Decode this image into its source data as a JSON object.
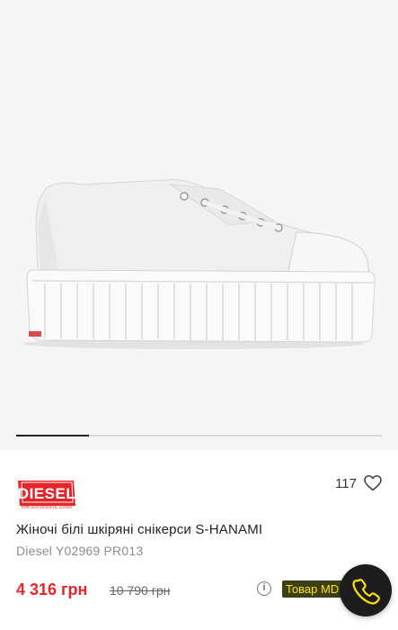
{
  "gallery": {
    "current_image_fraction": 0.2
  },
  "brand": {
    "logo_text": "DIESEL",
    "logo_tagline": "FOR SUCCESSFUL LIVING",
    "color": "#e4262b"
  },
  "likes": {
    "count": "117"
  },
  "product": {
    "title": "Жіночі білі шкіряні снікерси S-HANAMI",
    "sku": "Diesel Y02969 PR013",
    "price": "4 316 грн",
    "old_price": "10 790 грн",
    "price_color": "#e4262b"
  },
  "badge": {
    "text": "Товар МD"
  },
  "call": {
    "icon": "phone-icon",
    "icon_color": "#ffe100"
  }
}
